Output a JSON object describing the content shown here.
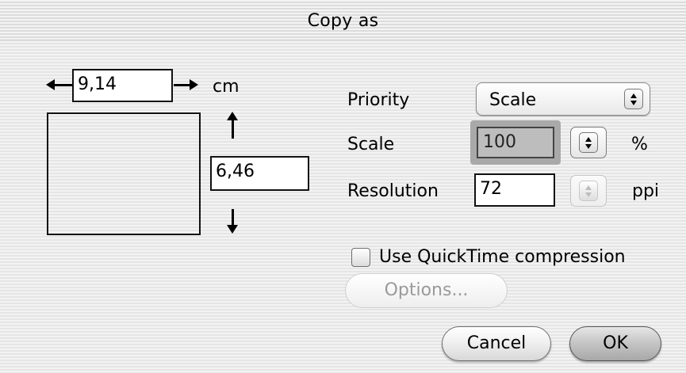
{
  "window": {
    "title": "Copy as"
  },
  "dimensions": {
    "width_value": "9,14",
    "height_value": "6,46",
    "unit": "cm"
  },
  "priority": {
    "label": "Priority",
    "value": "Scale"
  },
  "scale": {
    "label": "Scale",
    "value": "100",
    "unit": "%"
  },
  "resolution": {
    "label": "Resolution",
    "value": "72",
    "unit": "ppi"
  },
  "compression": {
    "label": "Use QuickTime compression",
    "checked": false
  },
  "buttons": {
    "options": "Options...",
    "cancel": "Cancel",
    "ok": "OK"
  },
  "icons": {
    "width_arrows": "left-right-arrow-icon",
    "height_arrows": "up-down-arrow-icon",
    "popup": "chevron-updown-icon",
    "stepper": "stepper-icon"
  }
}
